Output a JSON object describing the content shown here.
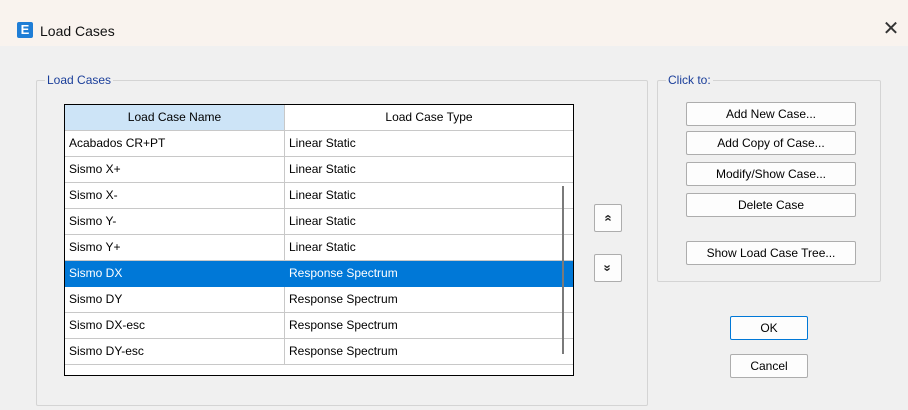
{
  "window": {
    "title": "Load Cases",
    "app_icon_glyph": "E",
    "close_glyph": "✕"
  },
  "load_cases_group": {
    "label": "Load Cases",
    "columns": [
      "Load Case Name",
      "Load Case Type"
    ],
    "rows": [
      {
        "name": "Acabados CR+PT",
        "type": "Linear Static"
      },
      {
        "name": "Sismo X+",
        "type": "Linear Static"
      },
      {
        "name": "Sismo X-",
        "type": "Linear Static"
      },
      {
        "name": "Sismo Y-",
        "type": "Linear Static"
      },
      {
        "name": "Sismo Y+",
        "type": "Linear Static"
      },
      {
        "name": "Sismo DX",
        "type": "Response Spectrum"
      },
      {
        "name": "Sismo DY",
        "type": "Response Spectrum"
      },
      {
        "name": "Sismo DX-esc",
        "type": "Response Spectrum"
      },
      {
        "name": "Sismo DY-esc",
        "type": "Response Spectrum"
      }
    ],
    "selected_row": "Sismo DX",
    "move_up_glyph": "»",
    "move_down_glyph": "»"
  },
  "click_to_group": {
    "label": "Click to:",
    "add_new_case": "Add New Case...",
    "add_copy_of_case": "Add Copy of Case...",
    "modify_show_case": "Modify/Show Case...",
    "delete_case": "Delete Case",
    "show_load_case_tree": "Show Load Case Tree..."
  },
  "dialog_buttons": {
    "ok": "OK",
    "cancel": "Cancel"
  },
  "colors": {
    "selection": "#0078d7",
    "header_highlight": "#cde4f7",
    "group_label": "#1a3e9a",
    "app_icon": "#1f7ed6"
  }
}
